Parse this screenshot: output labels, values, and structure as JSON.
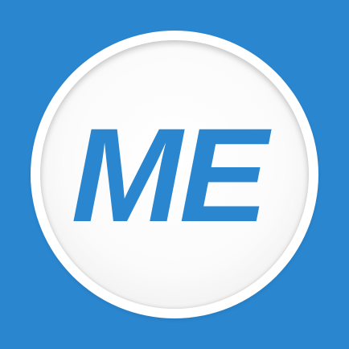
{
  "app_icon": {
    "logo_text": "ME",
    "background_color": "#2a86cf",
    "ring_color": "#ffffff",
    "text_color": "#2a86cf"
  }
}
